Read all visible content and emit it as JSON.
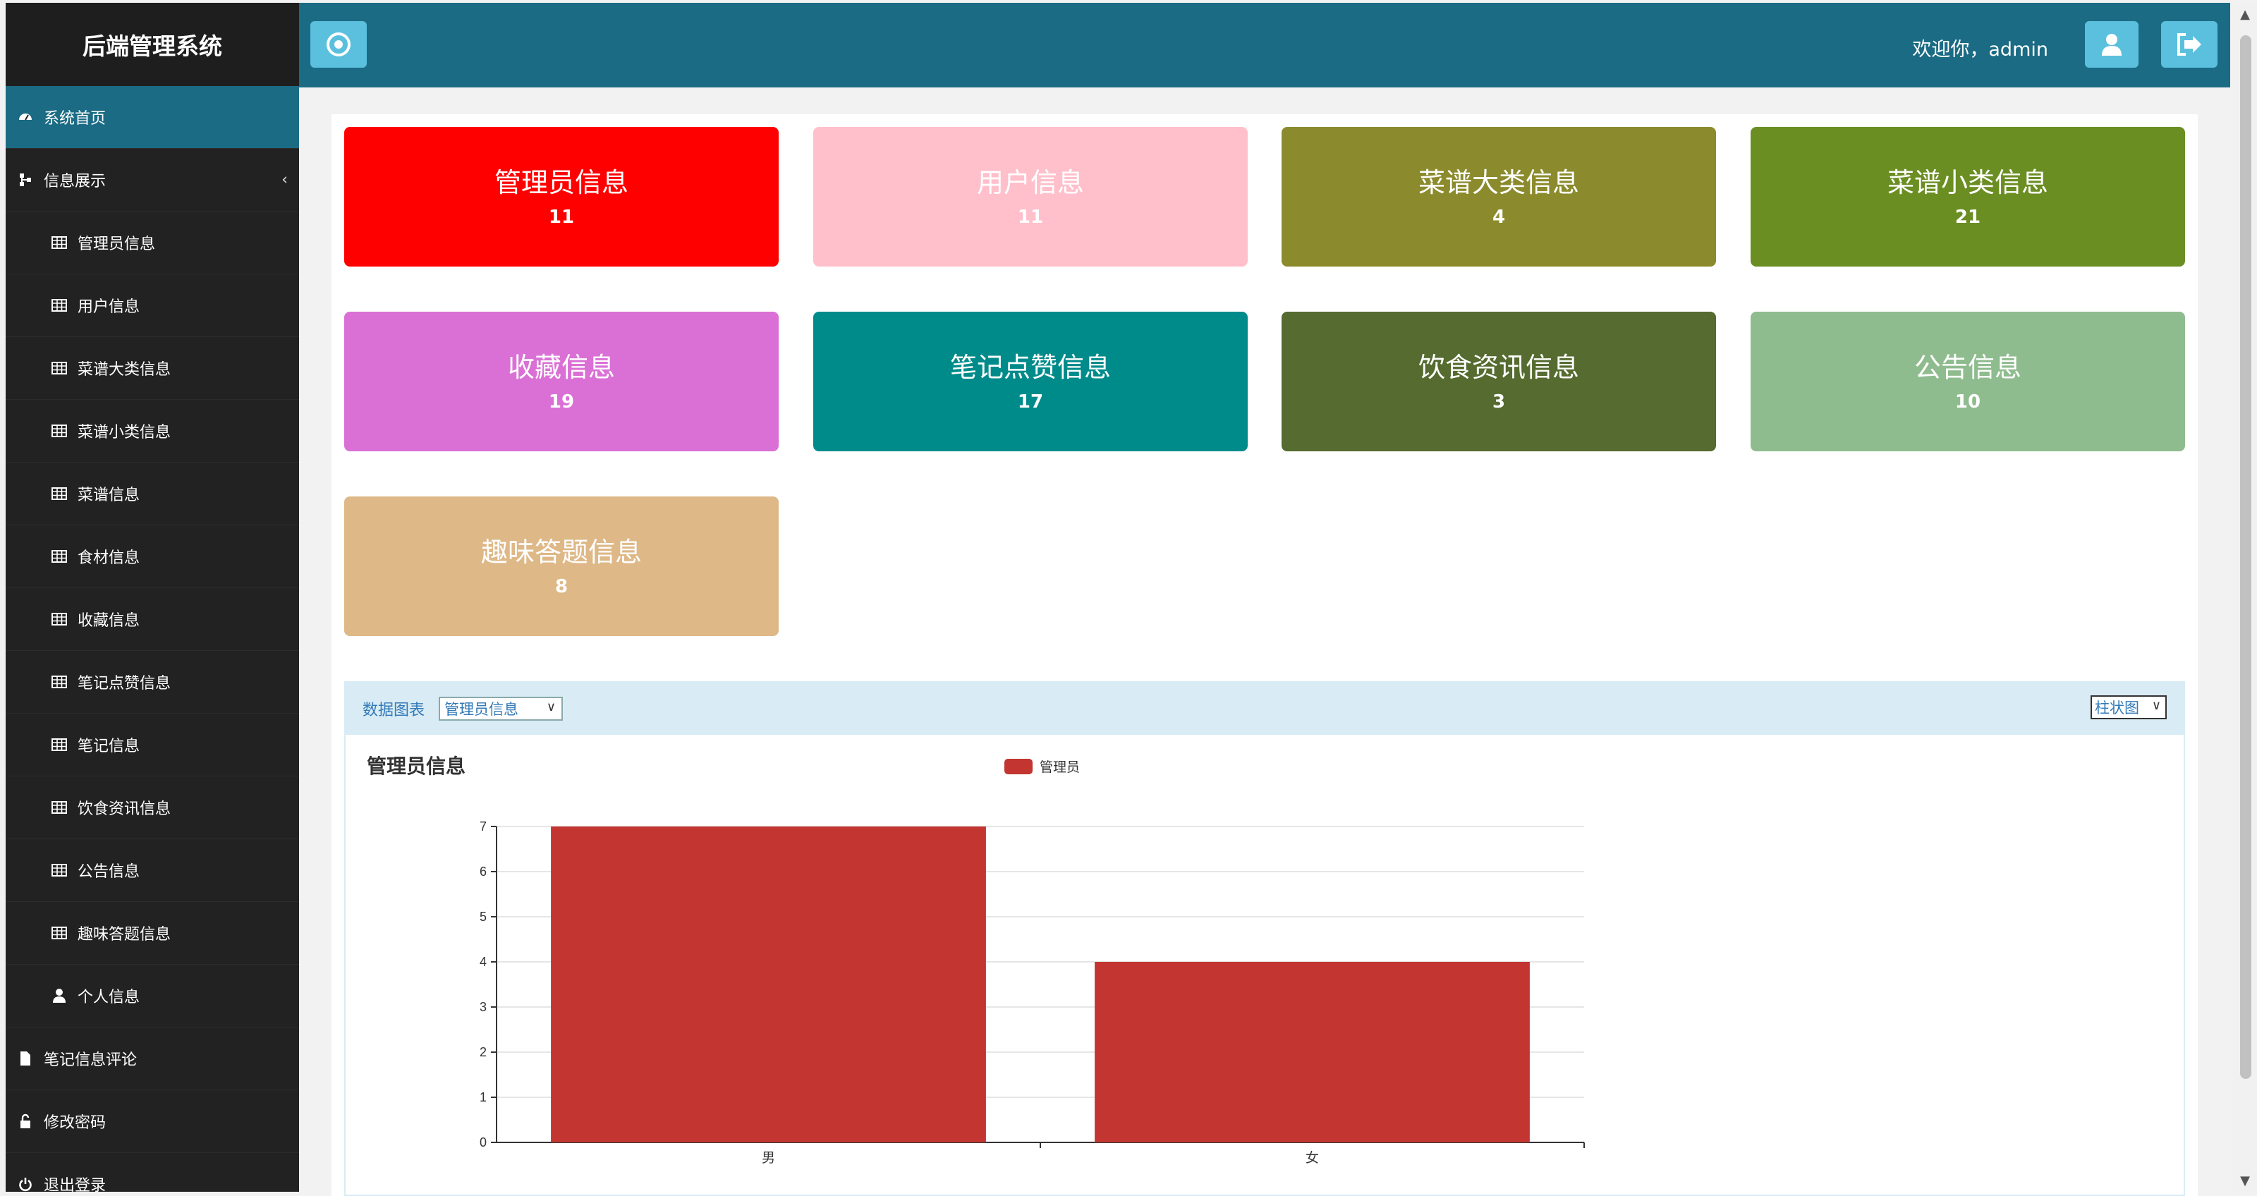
{
  "app_title": "后端管理系统",
  "header": {
    "welcome": "欢迎你，admin"
  },
  "sidebar": {
    "items": [
      {
        "label": "系统首页",
        "icon": "dashboard-icon",
        "level": "top",
        "active": true
      },
      {
        "label": "信息展示",
        "icon": "sitemap-icon",
        "level": "top",
        "expandable": true
      },
      {
        "label": "管理员信息",
        "icon": "table-icon",
        "level": "sub"
      },
      {
        "label": "用户信息",
        "icon": "table-icon",
        "level": "sub"
      },
      {
        "label": "菜谱大类信息",
        "icon": "table-icon",
        "level": "sub"
      },
      {
        "label": "菜谱小类信息",
        "icon": "table-icon",
        "level": "sub"
      },
      {
        "label": "菜谱信息",
        "icon": "table-icon",
        "level": "sub"
      },
      {
        "label": "食材信息",
        "icon": "table-icon",
        "level": "sub"
      },
      {
        "label": "收藏信息",
        "icon": "table-icon",
        "level": "sub"
      },
      {
        "label": "笔记点赞信息",
        "icon": "table-icon",
        "level": "sub"
      },
      {
        "label": "笔记信息",
        "icon": "table-icon",
        "level": "sub"
      },
      {
        "label": "饮食资讯信息",
        "icon": "table-icon",
        "level": "sub"
      },
      {
        "label": "公告信息",
        "icon": "table-icon",
        "level": "sub"
      },
      {
        "label": "趣味答题信息",
        "icon": "table-icon",
        "level": "sub"
      },
      {
        "label": "个人信息",
        "icon": "user-icon",
        "level": "sub"
      },
      {
        "label": "笔记信息评论",
        "icon": "file-icon",
        "level": "top"
      },
      {
        "label": "修改密码",
        "icon": "unlock-icon",
        "level": "top"
      },
      {
        "label": "退出登录",
        "icon": "power-icon",
        "level": "top"
      }
    ]
  },
  "cards": [
    {
      "title": "管理员信息",
      "count": "11",
      "color": "#ff0000"
    },
    {
      "title": "用户信息",
      "count": "11",
      "color": "#ffc0cb"
    },
    {
      "title": "菜谱大类信息",
      "count": "4",
      "color": "#8b8b2d"
    },
    {
      "title": "菜谱小类信息",
      "count": "21",
      "color": "#6b8e23"
    },
    {
      "title": "收藏信息",
      "count": "19",
      "color": "#da70d6"
    },
    {
      "title": "笔记点赞信息",
      "count": "17",
      "color": "#008b8b"
    },
    {
      "title": "饮食资讯信息",
      "count": "3",
      "color": "#556b2f"
    },
    {
      "title": "公告信息",
      "count": "10",
      "color": "#8fbc8f"
    },
    {
      "title": "趣味答题信息",
      "count": "8",
      "color": "#deb887"
    }
  ],
  "panel": {
    "label": "数据图表",
    "select_value": "管理员信息",
    "chart_type_value": "柱状图"
  },
  "chart_data": {
    "type": "bar",
    "title": "管理员信息",
    "categories": [
      "男",
      "女"
    ],
    "series": [
      {
        "name": "管理员",
        "values": [
          7,
          4
        ],
        "color": "#c23531"
      }
    ],
    "ylim": [
      0,
      7
    ],
    "yticks": [
      "0",
      "1",
      "2",
      "3",
      "4",
      "5",
      "6",
      "7"
    ],
    "grid": true,
    "legend_position": "top-center"
  }
}
